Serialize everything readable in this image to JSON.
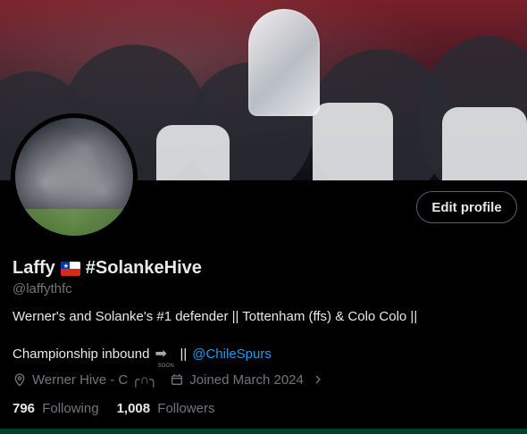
{
  "banner": {
    "alt": "Team celebration banner"
  },
  "profile": {
    "display_name": "Laffy",
    "display_name_suffix": "#SolankeHive",
    "handle": "@laffythfc",
    "edit_button_label": "Edit profile"
  },
  "bio": {
    "line1": "Werner's and Solanke's #1 defender || Tottenham (ffs) & Colo Colo ||",
    "line2_prefix": "Championship inbound",
    "soon_icon_text": "SOON",
    "line2_separator": "||",
    "mention": "@ChileSpurs"
  },
  "meta": {
    "location": "Werner Hive - C ╭∩╮",
    "joined": "Joined March 2024",
    "location_icon": "location-pin-icon",
    "calendar_icon": "calendar-icon",
    "chevron_icon": "chevron-right-icon"
  },
  "counts": {
    "following_value": "796",
    "following_label": "Following",
    "followers_value": "1,008",
    "followers_label": "Followers"
  },
  "colors": {
    "background": "#000000",
    "text_primary": "#e7e9ea",
    "text_secondary": "#71767b",
    "link": "#1d9bf0",
    "border": "#536471"
  }
}
